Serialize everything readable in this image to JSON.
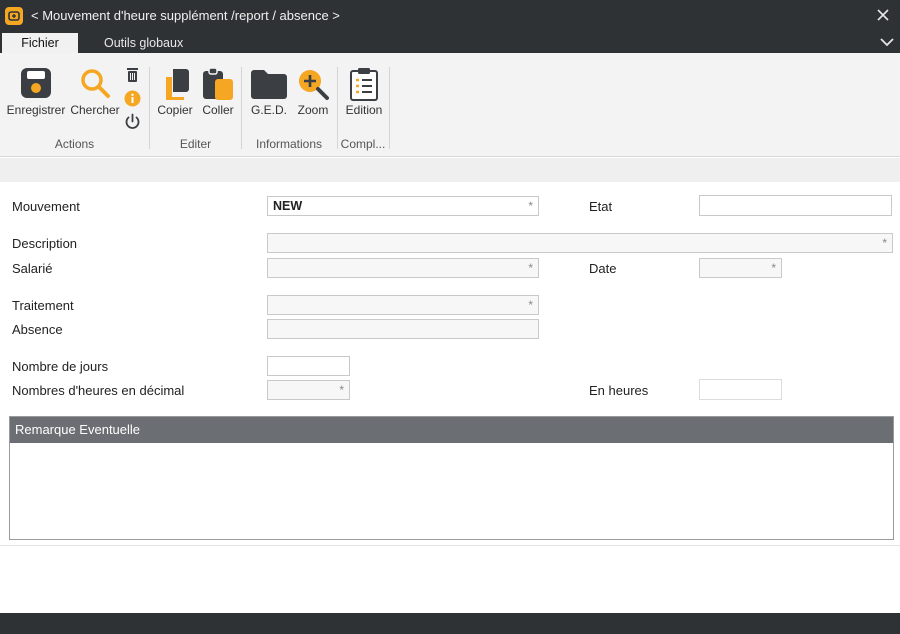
{
  "window": {
    "title": "< Mouvement d'heure supplément /report / absence >"
  },
  "ribbon_tabs": [
    {
      "label": "Fichier",
      "active": true
    },
    {
      "label": "Outils globaux",
      "active": false
    }
  ],
  "ribbon": {
    "buttons": {
      "save": "Enregistrer",
      "search": "Chercher",
      "copy": "Copier",
      "paste": "Coller",
      "ged": "G.E.D.",
      "zoom": "Zoom",
      "edition": "Edition"
    },
    "groups": {
      "actions": "Actions",
      "editer": "Editer",
      "informations": "Informations",
      "compl": "Compl..."
    },
    "accent_color": "#f5a623",
    "icon_dark": "#3b3e42"
  },
  "form": {
    "labels": {
      "mouvement": "Mouvement",
      "etat": "Etat",
      "description": "Description",
      "salarie": "Salarié",
      "date": "Date",
      "traitement": "Traitement",
      "absence": "Absence",
      "nombre_jours": "Nombre de jours",
      "nombre_heures": "Nombres d'heures en décimal",
      "en_heures": "En heures"
    },
    "values": {
      "mouvement": "NEW",
      "etat": "",
      "description": "",
      "salarie": "",
      "date": "",
      "traitement": "",
      "absence": "",
      "nombre_jours": "",
      "nombre_heures": "",
      "en_heures": ""
    },
    "remark": {
      "title": "Remarque Eventuelle",
      "text": ""
    }
  }
}
